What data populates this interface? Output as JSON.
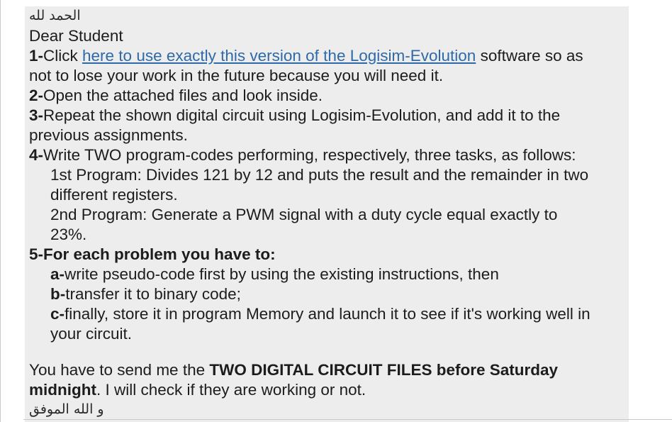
{
  "message": {
    "arabic_header": "الحمد لله",
    "greeting": "Dear Student",
    "item1": {
      "num": "1-",
      "before_link": "Click ",
      "link_text": "here to use exactly this version of the Logisim-Evolution",
      "after_link_line1": " software so as",
      "line2": "not to lose your work in the future because you will need it."
    },
    "item2": {
      "num": "2-",
      "text": "Open the attached files and look inside."
    },
    "item3": {
      "num": "3-",
      "line1": "Repeat the shown digital circuit using Logisim-Evolution, and add it to the",
      "line2": "previous assignments."
    },
    "item4": {
      "num": "4-",
      "text": "Write TWO program-codes performing, respectively, three tasks, as follows:",
      "program1_line1": "1st Program: Divides 121 by 12 and puts the result and the remainder in two",
      "program1_line2": "different registers.",
      "program2_line1": "2nd Program: Generate a PWM signal with a duty cycle equal exactly to",
      "program2_line2": "23%."
    },
    "item5": {
      "num": "5-",
      "text": "For each problem you have to:",
      "a_label": "a-",
      "a_text": "write pseudo-code first by using the existing instructions, then",
      "b_label": "b-",
      "b_text": "transfer it to binary code;",
      "c_label": "c-",
      "c_text_line1": "finally, store it in program Memory and launch it to see if it's working well in",
      "c_text_line2": "your circuit."
    },
    "closing": {
      "before_bold": "You have to send me the ",
      "bold_line1": "TWO DIGITAL CIRCUIT FILES before Saturday",
      "bold_line2": "midnight",
      "after_bold": ". I will check if they are working or not."
    },
    "arabic_footer": "و الله الموفق"
  },
  "colors": {
    "message_background": "#ededed",
    "link": "#2e6aa8",
    "text": "#1c1c1c"
  }
}
